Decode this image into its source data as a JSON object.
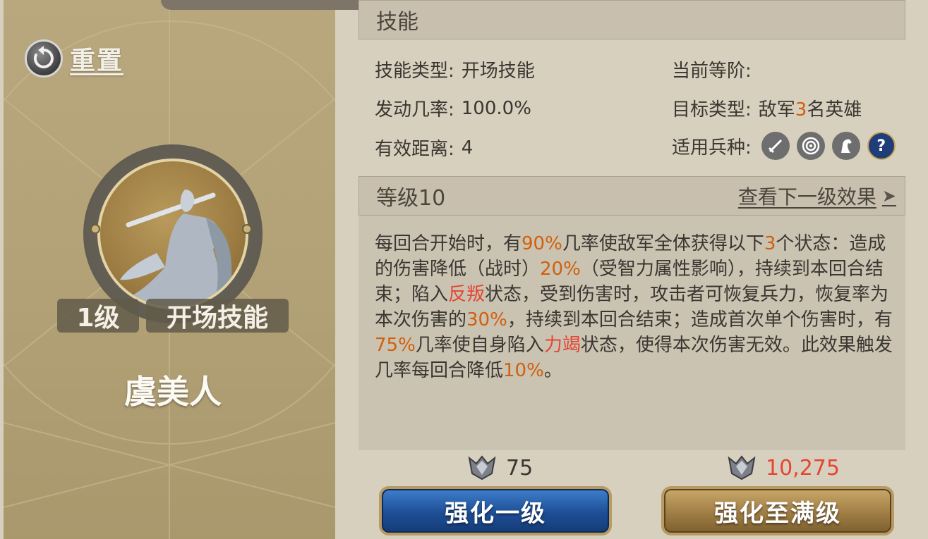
{
  "left": {
    "reset_label": "重置",
    "level_tag": "1级",
    "skill_kind_tag": "开场技能",
    "hero_name": "虞美人"
  },
  "skill_section": {
    "title": "技能",
    "type_label": "技能类型:",
    "type_value": "开场技能",
    "current_rank_label": "当前等阶:",
    "current_rank_value": "",
    "rate_label": "发动几率:",
    "rate_value": "100.0%",
    "target_label": "目标类型:",
    "target_pre": "敌军",
    "target_count": "3",
    "target_post": "名英雄",
    "range_label": "有效距离:",
    "range_value": "4",
    "troop_label": "适用兵种:",
    "troop_icons": [
      "sword-icon",
      "target-icon",
      "horse-icon",
      "question-icon"
    ]
  },
  "level_section": {
    "title": "等级10",
    "next_link": "查看下一级效果"
  },
  "description": [
    {
      "t": "每回合开始时，有",
      "c": ""
    },
    {
      "t": "90%",
      "c": "orange"
    },
    {
      "t": "几率使敌军全体获得以下",
      "c": ""
    },
    {
      "t": "3",
      "c": "orange"
    },
    {
      "t": "个状态：造成的伤害降低（战时）",
      "c": ""
    },
    {
      "t": "20%",
      "c": "orange"
    },
    {
      "t": "（受智力属性影响），持续到本回合结束；陷入",
      "c": ""
    },
    {
      "t": "反叛",
      "c": "red"
    },
    {
      "t": "状态，受到伤害时，攻击者可恢复兵力，恢复率为本次伤害的",
      "c": ""
    },
    {
      "t": "30%",
      "c": "orange"
    },
    {
      "t": "，持续到本回合结束；造成首次单个伤害时，有",
      "c": ""
    },
    {
      "t": "75%",
      "c": "orange"
    },
    {
      "t": "几率使自身陷入",
      "c": ""
    },
    {
      "t": "力竭",
      "c": "red"
    },
    {
      "t": "状态，使得本次伤害无效。此效果触发几率每回合降低",
      "c": ""
    },
    {
      "t": "10%",
      "c": "orange"
    },
    {
      "t": "。",
      "c": ""
    }
  ],
  "costs": {
    "one_level": "75",
    "max_level": "10,275"
  },
  "buttons": {
    "upgrade_one": "强化一级",
    "upgrade_max": "强化至满级"
  },
  "colors": {
    "highlight_orange": "#d0600d",
    "highlight_red": "#e54533",
    "button_blue": "#1e4e96",
    "button_gold": "#a07e45"
  }
}
